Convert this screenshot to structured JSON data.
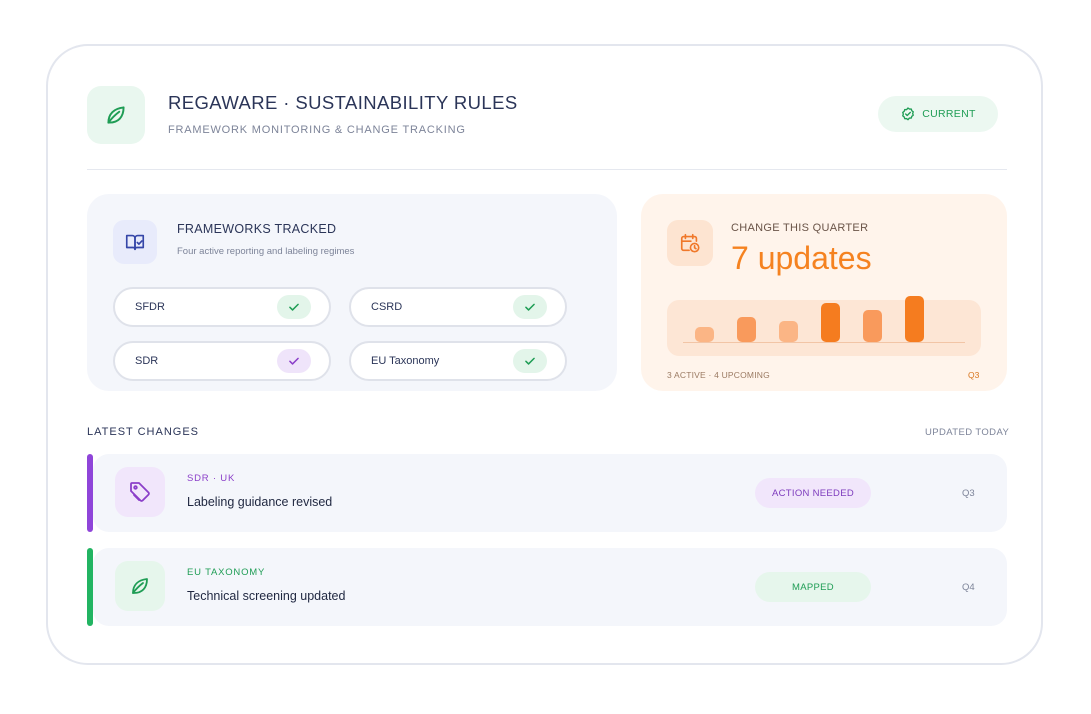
{
  "header": {
    "title": "REGAWARE · SUSTAINABILITY RULES",
    "subtitle": "FRAMEWORK MONITORING & CHANGE TRACKING",
    "status_label": "CURRENT",
    "logo_icon": "leaf-icon",
    "status_icon": "check-circle-icon"
  },
  "frameworks": {
    "title": "FRAMEWORKS TRACKED",
    "subtitle": "Four active reporting and labeling regimes",
    "icon": "book-check-icon",
    "items": [
      {
        "name": "SFDR",
        "check_color": "#1f9d55"
      },
      {
        "name": "CSRD",
        "check_color": "#1f9d55"
      },
      {
        "name": "SDR",
        "check_color": "#8b3fc9"
      },
      {
        "name": "EU Taxonomy",
        "check_color": "#1f9d55"
      }
    ]
  },
  "change": {
    "title": "CHANGE THIS QUARTER",
    "value": "7 updates",
    "icon": "calendar-clock-icon",
    "footer_left": "3 ACTIVE · 4 UPCOMING",
    "footer_right": "Q3",
    "bars": [
      {
        "level": 0.33,
        "color": "#fbb585"
      },
      {
        "level": 0.55,
        "color": "#f99a5c"
      },
      {
        "level": 0.45,
        "color": "#fbb585"
      },
      {
        "level": 0.85,
        "color": "#f57c1f"
      },
      {
        "level": 0.7,
        "color": "#f99a5c"
      },
      {
        "level": 1.0,
        "color": "#f57c1f"
      }
    ]
  },
  "latest": {
    "title": "LATEST CHANGES",
    "updated": "UPDATED TODAY",
    "rows": [
      {
        "tag": "SDR · UK",
        "desc": "Labeling guidance revised",
        "badge": "ACTION NEEDED",
        "quarter": "Q3",
        "icon": "tag-icon",
        "accent": "#8f45d9",
        "tag_color": "#8b3fc9",
        "icon_bg": "#f1e6fb",
        "badge_bg": "#f1e6fb",
        "badge_color": "#7d3bbd"
      },
      {
        "tag": "EU TAXONOMY",
        "desc": "Technical screening updated",
        "badge": "MAPPED",
        "quarter": "Q4",
        "icon": "leaf-icon",
        "accent": "#22b462",
        "tag_color": "#1f9d55",
        "icon_bg": "#e6f6ec",
        "badge_bg": "#e6f6ec",
        "badge_color": "#1f9d55"
      }
    ]
  }
}
